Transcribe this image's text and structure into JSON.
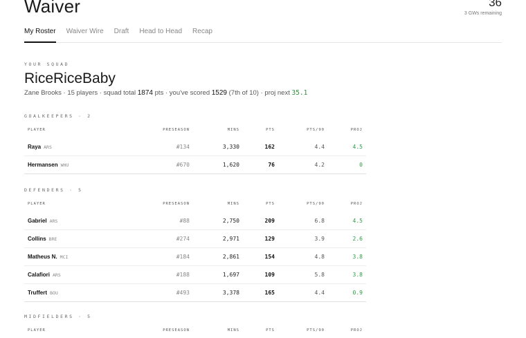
{
  "header": {
    "title": "Waiver",
    "gw_number": "36",
    "gw_remaining": "3 GWs remaining"
  },
  "tabs": [
    {
      "label": "My Roster",
      "active": true
    },
    {
      "label": "Waiver Wire",
      "active": false
    },
    {
      "label": "Draft",
      "active": false
    },
    {
      "label": "Head to Head",
      "active": false
    },
    {
      "label": "Recap",
      "active": false
    }
  ],
  "squad": {
    "label": "YOUR SQUAD",
    "name": "RiceRiceBaby",
    "manager": "Zane Brooks",
    "players_text": "15 players",
    "squad_total_label": "squad total",
    "squad_total": "1874",
    "pts_label": "pts",
    "scored_label": "you've scored",
    "scored": "1529",
    "rank_text": "(7th of 10)",
    "proj_label": "proj next",
    "proj_next": "35.1"
  },
  "columns": {
    "player": "PLAYER",
    "preseason": "PRESEASON",
    "mins": "MINS",
    "pts": "PTS",
    "pts90": "PTS/90",
    "proj": "PROJ"
  },
  "sections": [
    {
      "label": "GOALKEEPERS · 2",
      "players": [
        {
          "name": "Raya",
          "club": "ARS",
          "preseason": "#134",
          "mins": "3,330",
          "pts": "162",
          "pts90": "4.4",
          "proj": "4.5"
        },
        {
          "name": "Hermansen",
          "club": "WHU",
          "preseason": "#670",
          "mins": "1,620",
          "pts": "76",
          "pts90": "4.2",
          "proj": "0"
        }
      ]
    },
    {
      "label": "DEFENDERS · 5",
      "players": [
        {
          "name": "Gabriel",
          "club": "ARS",
          "preseason": "#88",
          "mins": "2,750",
          "pts": "209",
          "pts90": "6.8",
          "proj": "4.5"
        },
        {
          "name": "Collins",
          "club": "BRE",
          "preseason": "#274",
          "mins": "2,971",
          "pts": "129",
          "pts90": "3.9",
          "proj": "2.6"
        },
        {
          "name": "Matheus N.",
          "club": "MCI",
          "preseason": "#184",
          "mins": "2,861",
          "pts": "154",
          "pts90": "4.8",
          "proj": "3.8"
        },
        {
          "name": "Calafiori",
          "club": "ARS",
          "preseason": "#188",
          "mins": "1,697",
          "pts": "109",
          "pts90": "5.8",
          "proj": "3.8"
        },
        {
          "name": "Truffert",
          "club": "BOU",
          "preseason": "#493",
          "mins": "3,378",
          "pts": "165",
          "pts90": "4.4",
          "proj": "0.9"
        }
      ]
    },
    {
      "label": "MIDFIELDERS · 5",
      "players": []
    }
  ],
  "colors": {
    "proj_green": "#2e9b45",
    "text": "#1a1a1a",
    "muted": "#888888"
  }
}
